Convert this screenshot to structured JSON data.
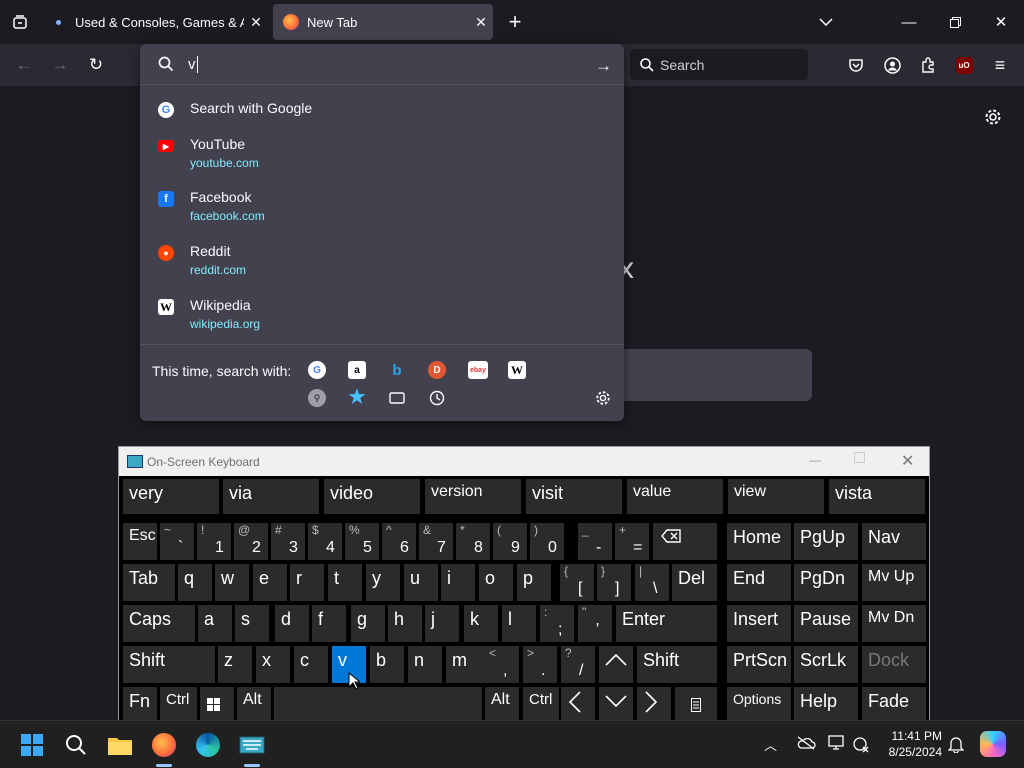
{
  "browser": {
    "tabs": [
      {
        "title": "Used & Consoles, Games & Accessories"
      },
      {
        "title": "New Tab"
      }
    ],
    "search_placeholder": "Search",
    "url_value": "v"
  },
  "urlbar_popup": {
    "heuristic": "Search with Google",
    "results": [
      {
        "title": "YouTube",
        "url": "youtube.com",
        "icon": "youtube-icon",
        "color": "#ff0000"
      },
      {
        "title": "Facebook",
        "url": "facebook.com",
        "icon": "facebook-icon",
        "color": "#1877f2"
      },
      {
        "title": "Reddit",
        "url": "reddit.com",
        "icon": "reddit-icon",
        "color": "#ff4500"
      },
      {
        "title": "Wikipedia",
        "url": "wikipedia.org",
        "icon": "wikipedia-icon",
        "color": "#ffffff"
      }
    ],
    "oneoff_label": "This time, search with:",
    "engines": [
      "Google",
      "Amazon",
      "Bing",
      "DuckDuckGo",
      "eBay",
      "Wikipedia"
    ]
  },
  "osk": {
    "title": "On-Screen Keyboard",
    "suggestions": [
      "very",
      "via",
      "video",
      "version",
      "visit",
      "value",
      "view",
      "vista"
    ],
    "row1": {
      "esc": "Esc",
      "nums": [
        {
          "s": "~",
          "m": "`"
        },
        {
          "s": "!",
          "m": "1"
        },
        {
          "s": "@",
          "m": "2"
        },
        {
          "s": "#",
          "m": "3"
        },
        {
          "s": "$",
          "m": "4"
        },
        {
          "s": "%",
          "m": "5"
        },
        {
          "s": "^",
          "m": "6"
        },
        {
          "s": "&",
          "m": "7"
        },
        {
          "s": "*",
          "m": "8"
        },
        {
          "s": "(",
          "m": "9"
        },
        {
          "s": ")",
          "m": "0"
        },
        {
          "s": "_",
          "m": "-"
        },
        {
          "s": "+",
          "m": "="
        }
      ]
    },
    "row2": {
      "tab": "Tab",
      "letters": [
        "q",
        "w",
        "e",
        "r",
        "t",
        "y",
        "u",
        "i",
        "o",
        "p"
      ],
      "punct": [
        {
          "s": "{",
          "m": "["
        },
        {
          "s": "}",
          "m": "]"
        },
        {
          "s": "|",
          "m": "\\"
        }
      ],
      "del": "Del"
    },
    "row3": {
      "caps": "Caps",
      "letters": [
        "a",
        "s",
        "d",
        "f",
        "g",
        "h",
        "j",
        "k",
        "l"
      ],
      "punct": [
        {
          "s": ":",
          "m": ";"
        },
        {
          "s": "\"",
          "m": "'"
        }
      ],
      "enter": "Enter"
    },
    "row4": {
      "shift": "Shift",
      "letters": [
        "z",
        "x",
        "c",
        "v",
        "b",
        "n",
        "m"
      ],
      "punct": [
        {
          "s": "<",
          "m": ","
        },
        {
          "s": ">",
          "m": "."
        },
        {
          "s": "?",
          "m": "/"
        }
      ],
      "shift_r": "Shift"
    },
    "row5": {
      "fn": "Fn",
      "ctrl": "Ctrl",
      "alt": "Alt",
      "alt_r": "Alt",
      "ctrl_r": "Ctrl"
    },
    "right": {
      "home": "Home",
      "pgup": "PgUp",
      "nav": "Nav",
      "end": "End",
      "pgdn": "PgDn",
      "mvup": "Mv Up",
      "insert": "Insert",
      "pause": "Pause",
      "mvdn": "Mv Dn",
      "prtscn": "PrtScn",
      "scrlk": "ScrLk",
      "dock": "Dock",
      "options": "Options",
      "help": "Help",
      "fade": "Fade"
    }
  },
  "taskbar": {
    "time": "11:41 PM",
    "date": "8/25/2024"
  },
  "colors": {
    "accent": "#0078d7",
    "link": "#80ebff"
  }
}
